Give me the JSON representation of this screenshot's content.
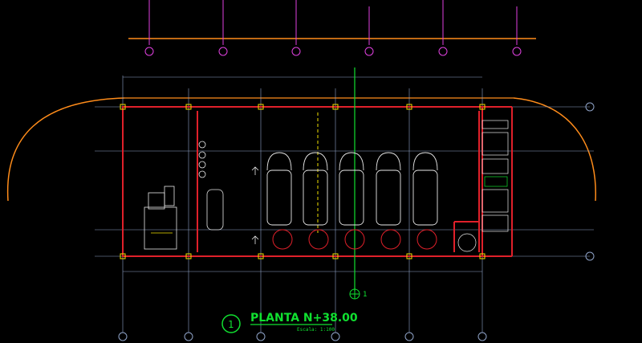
{
  "drawing": {
    "title": "PLANTA N+38.00",
    "scale": "Escala: 1:100",
    "view_number": "1",
    "section_mark": "1"
  },
  "colors": {
    "background": "#000000",
    "grid": "#8fa3c8",
    "wall": "#e0202a",
    "magenta": "#e040e0",
    "orange": "#ff8c1a",
    "green": "#10e030",
    "yellow": "#f0e000",
    "white": "#e8e8e8",
    "cyan": "#30d0e0"
  },
  "icons": [
    "grid-bubble-icon",
    "section-arrow-icon",
    "north-arrow-icon"
  ]
}
